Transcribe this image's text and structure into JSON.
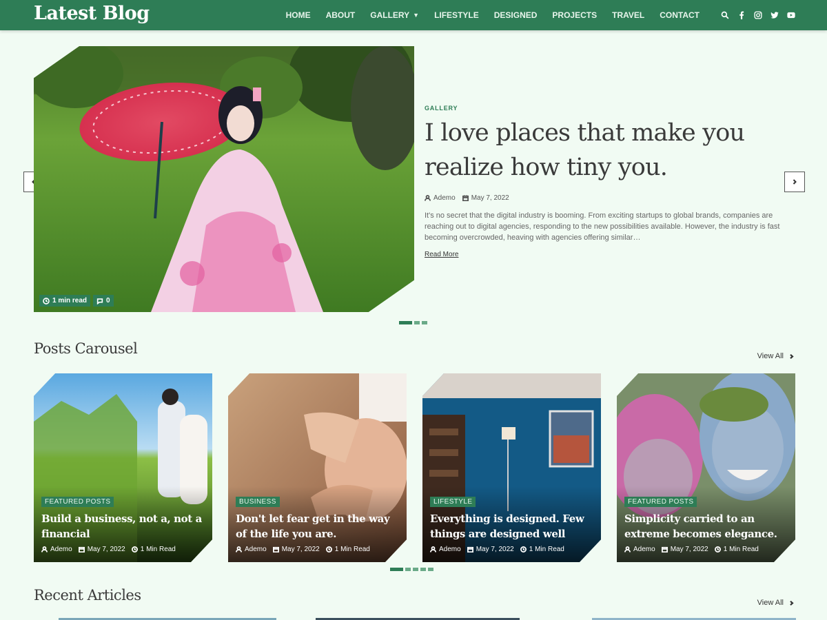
{
  "header": {
    "logo": "Latest Blog",
    "nav": [
      {
        "label": "HOME"
      },
      {
        "label": "ABOUT"
      },
      {
        "label": "GALLERY",
        "has_dropdown": true
      },
      {
        "label": "LIFESTYLE"
      },
      {
        "label": "DESIGNED"
      },
      {
        "label": "PROJECTS"
      },
      {
        "label": "TRAVEL"
      },
      {
        "label": "CONTACT"
      }
    ],
    "icons": [
      "search-icon",
      "facebook-icon",
      "instagram-icon",
      "twitter-icon",
      "youtube-icon"
    ]
  },
  "hero": {
    "category": "GALLERY",
    "title": "I love places that make you realize how tiny you.",
    "author": "Ademo",
    "date": "May 7, 2022",
    "excerpt": "It's no secret that the digital industry is booming. From exciting startups to global brands, companies are reaching out to digital agencies, responding to the new possibilities available. However, the industry is fast becoming overcrowded, heaving with agencies offering similar…",
    "read_more": "Read More",
    "read_time": "1 min read",
    "comments": "0",
    "slides": 3,
    "active_slide": 1
  },
  "posts_carousel": {
    "title": "Posts Carousel",
    "view_all": "View All",
    "cards": [
      {
        "category": "FEATURED POSTS",
        "title": "Build a business, not a, not a financial",
        "author": "Ademo",
        "date": "May 7, 2022",
        "read": "1 Min Read"
      },
      {
        "category": "BUSINESS",
        "title": "Don't let fear get in the way of the life you are.",
        "author": "Ademo",
        "date": "May 7, 2022",
        "read": "1 Min Read"
      },
      {
        "category": "LIFESTYLE",
        "title": "Everything is designed. Few things are designed well",
        "author": "Ademo",
        "date": "May 7, 2022",
        "read": "1 Min Read"
      },
      {
        "category": "FEATURED POSTS",
        "title": "Simplicity carried to an extreme becomes elegance.",
        "author": "Ademo",
        "date": "May 7, 2022",
        "read": "1 Min Read"
      }
    ],
    "pages": 5,
    "active_page": 1
  },
  "recent": {
    "title": "Recent Articles",
    "view_all": "View All"
  },
  "colors": {
    "brand": "#2e7d56",
    "background": "#f1fbf3"
  }
}
